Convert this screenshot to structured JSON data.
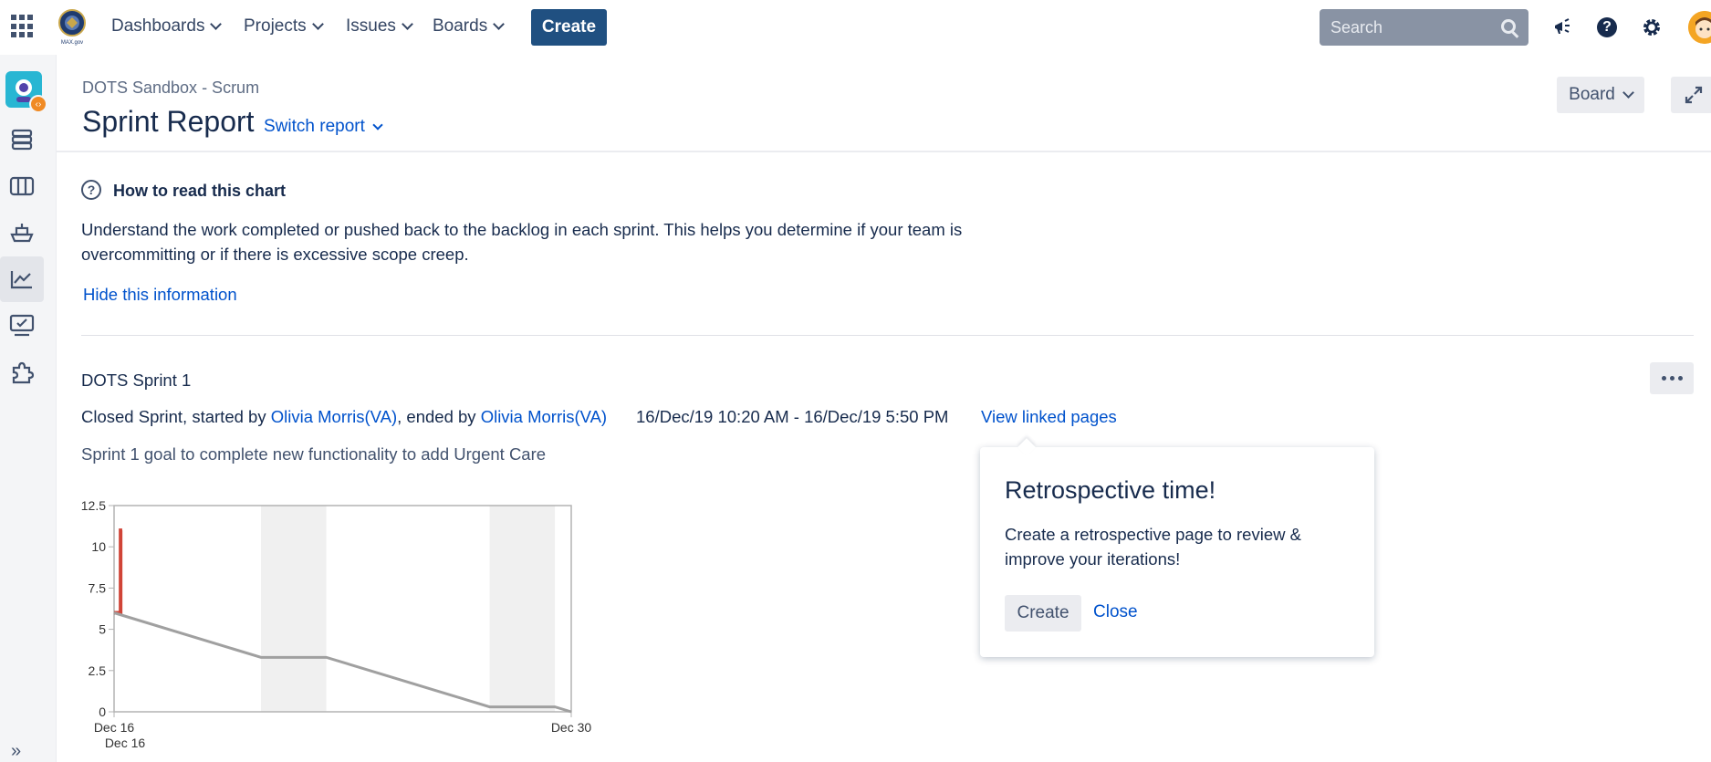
{
  "topnav": {
    "items": [
      {
        "label": "Dashboards"
      },
      {
        "label": "Projects"
      },
      {
        "label": "Issues"
      },
      {
        "label": "Boards"
      }
    ],
    "create_label": "Create",
    "search_placeholder": "Search",
    "logo_text": "MAX.gov"
  },
  "header": {
    "breadcrumb": "DOTS Sandbox - Scrum",
    "title": "Sprint Report",
    "switch_report_label": "Switch report",
    "board_label": "Board"
  },
  "info": {
    "icon": "?",
    "title": "How to read this chart",
    "text": "Understand the work completed or pushed back to the backlog in each sprint. This helps you determine if your team is overcommitting or if there is excessive scope creep.",
    "hide_label": "Hide this information"
  },
  "sprint": {
    "name": "DOTS Sprint 1",
    "status_prefix": "Closed Sprint, started by ",
    "started_by": "Olivia Morris(VA)",
    "ended_prefix": ", ended by ",
    "ended_by": "Olivia Morris(VA)",
    "dates": "16/Dec/19 10:20 AM - 16/Dec/19 5:50 PM",
    "view_linked_label": "View linked pages",
    "goal": "Sprint 1 goal to complete new functionality to add Urgent Care"
  },
  "popover": {
    "title": "Retrospective time!",
    "text": "Create a retrospective page to review & improve your iterations!",
    "create_label": "Create",
    "close_label": "Close"
  },
  "colors": {
    "brand_nav_button": "#205081",
    "link": "#0052cc",
    "scope_line": "#d04437",
    "remaining_line": "#a0a0a0",
    "nonworking_band": "#f0f0f0"
  },
  "chart_data": {
    "type": "line",
    "title": "",
    "xlabel": "",
    "ylabel": "",
    "ylim": [
      0,
      12.5
    ],
    "y_ticks": [
      "0",
      "2.5",
      "5",
      "7.5",
      "10",
      "12.5"
    ],
    "x_tick_labels": [
      "Dec 16",
      "Dec 30"
    ],
    "x_sub_label": "Dec 16",
    "xlim_days": [
      16,
      30
    ],
    "nonworking_bands": [
      [
        20.5,
        22.5
      ],
      [
        27.5,
        29.5
      ]
    ],
    "series": [
      {
        "values_x": [
          16,
          16.05,
          16.2,
          16.2,
          16.25
        ],
        "values_y": [
          6,
          6,
          6,
          11,
          11
        ]
      },
      {
        "values_x": [
          16,
          20.5,
          22.5,
          27.5,
          29.5,
          30
        ],
        "values_y": [
          6,
          3.3,
          3.3,
          0.3,
          0.3,
          0
        ]
      }
    ]
  }
}
